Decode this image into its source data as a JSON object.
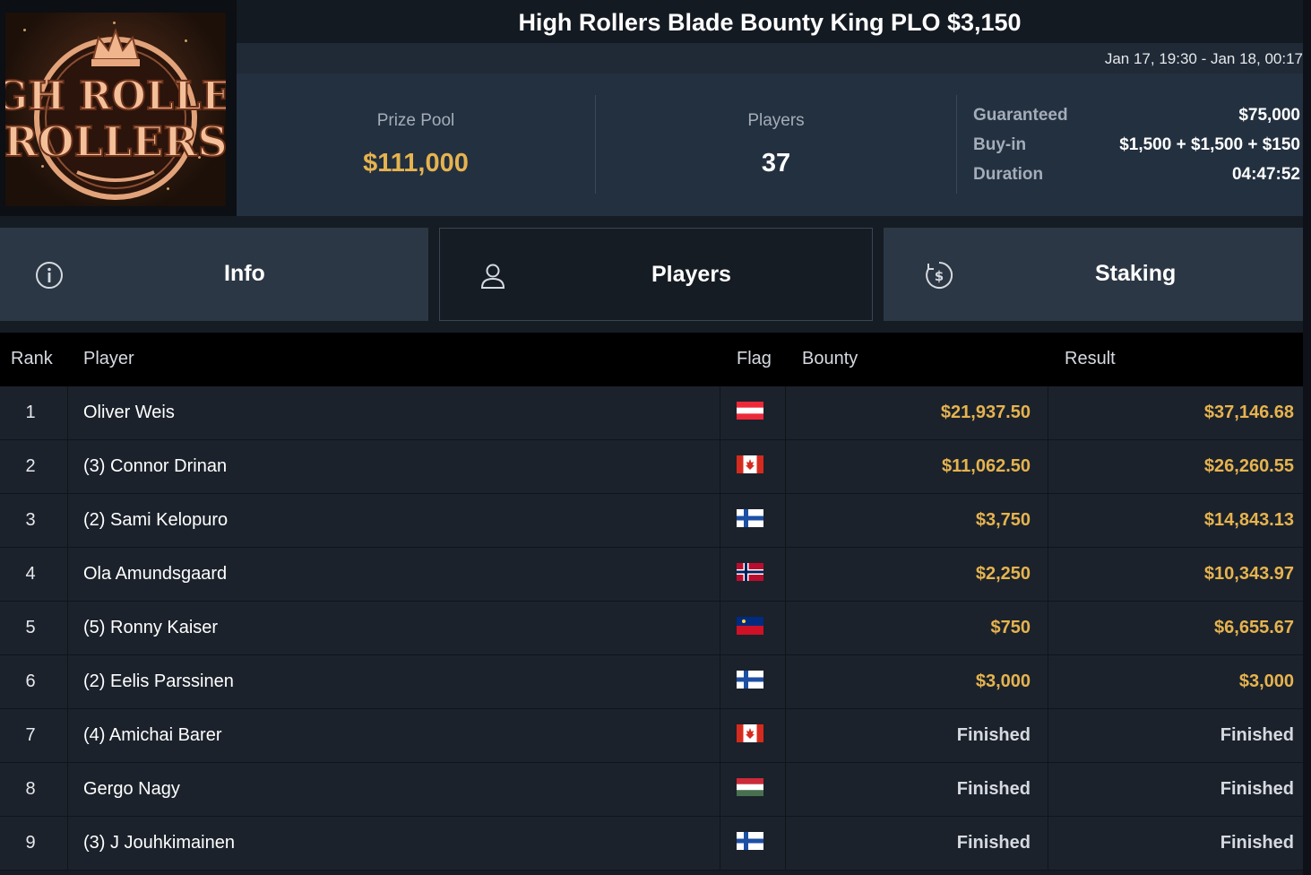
{
  "header": {
    "logo_text": "HIGH ROLLERS",
    "title": "High Rollers Blade Bounty King PLO $3,150",
    "date": "Jan 17, 19:30 - Jan 18, 00:17"
  },
  "stats": {
    "prize_pool_label": "Prize Pool",
    "prize_pool_value": "$111,000",
    "players_label": "Players",
    "players_value": "37",
    "guaranteed_label": "Guaranteed",
    "guaranteed_value": "$75,000",
    "buyin_label": "Buy-in",
    "buyin_value": "$1,500 + $1,500 + $150",
    "duration_label": "Duration",
    "duration_value": "04:47:52"
  },
  "tabs": [
    {
      "label": "Info",
      "icon": "info-icon"
    },
    {
      "label": "Players",
      "icon": "user-icon",
      "active": true
    },
    {
      "label": "Staking",
      "icon": "dollar-coin-icon"
    }
  ],
  "table": {
    "headers": {
      "rank": "Rank",
      "player": "Player",
      "flag": "Flag",
      "bounty": "Bounty",
      "result": "Result"
    },
    "rows": [
      {
        "rank": "1",
        "player": "Oliver Weis",
        "flag": "austria",
        "bounty": "$21,937.50",
        "result": "$37,146.68"
      },
      {
        "rank": "2",
        "player": "(3) Connor Drinan",
        "flag": "canada",
        "bounty": "$11,062.50",
        "result": "$26,260.55"
      },
      {
        "rank": "3",
        "player": "(2) Sami Kelopuro",
        "flag": "finland",
        "bounty": "$3,750",
        "result": "$14,843.13"
      },
      {
        "rank": "4",
        "player": "Ola Amundsgaard",
        "flag": "norway",
        "bounty": "$2,250",
        "result": "$10,343.97"
      },
      {
        "rank": "5",
        "player": "(5) Ronny Kaiser",
        "flag": "liechtenstein",
        "bounty": "$750",
        "result": "$6,655.67"
      },
      {
        "rank": "6",
        "player": "(2) Eelis Parssinen",
        "flag": "finland",
        "bounty": "$3,000",
        "result": "$3,000"
      },
      {
        "rank": "7",
        "player": "(4) Amichai Barer",
        "flag": "canada",
        "bounty": "Finished",
        "result": "Finished"
      },
      {
        "rank": "8",
        "player": "Gergo Nagy",
        "flag": "hungary",
        "bounty": "Finished",
        "result": "Finished"
      },
      {
        "rank": "9",
        "player": "(3) J Jouhkimainen",
        "flag": "finland",
        "bounty": "Finished",
        "result": "Finished"
      }
    ]
  },
  "colors": {
    "gold": "#e6b34f",
    "panel": "#233040",
    "tab_inactive": "#2b3744",
    "row_bg": "#1b222b"
  }
}
